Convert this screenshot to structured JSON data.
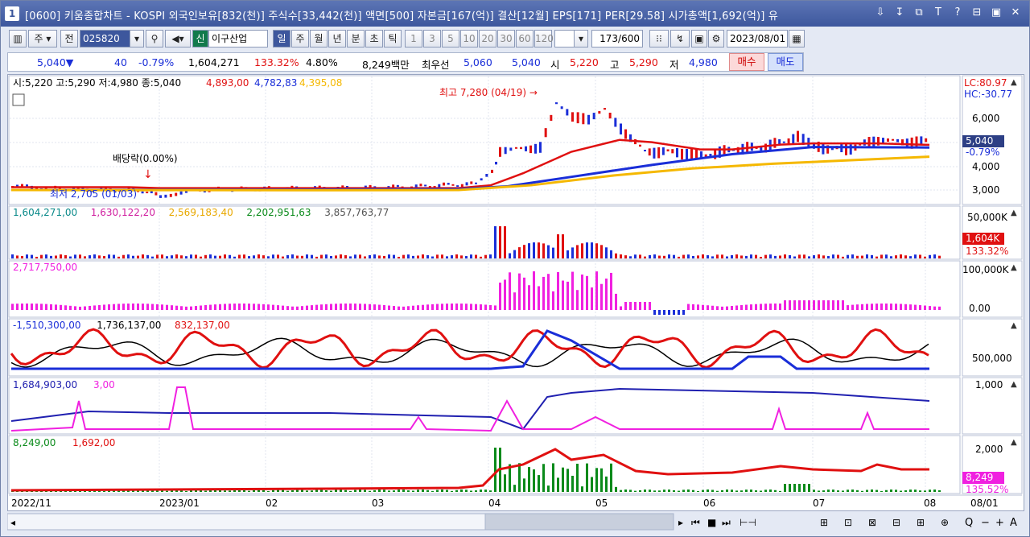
{
  "title": {
    "window_num": "1",
    "text": "[0600] 키움종합차트 - KOSPI 외국인보유[832(천)] 주식수[33,442(천)] 액면[500] 자본금[167(억)] 결산[12월] EPS[171] PER[29.58] 시가총액[1,692(억)] 유",
    "buttons": [
      "⇩",
      "↧",
      "⧉",
      "T",
      "?",
      "⊟",
      "▣",
      "✕"
    ]
  },
  "toolbar": {
    "period": "주",
    "prev": "전",
    "code": "025820",
    "stock_badge": "신",
    "stock_name": "이구산업",
    "intervals": [
      "일",
      "주",
      "월",
      "년",
      "분",
      "초",
      "틱"
    ],
    "numbers": [
      "1",
      "3",
      "5",
      "10",
      "20",
      "30",
      "60",
      "120"
    ],
    "count": "173/600",
    "date": "2023/08/01"
  },
  "quote": {
    "price": "5,040▼",
    "change": "40",
    "pct": "-0.79%",
    "volume": "1,604,271",
    "vol_ratio": "133.32%",
    "turnover": "4.80%",
    "amount": "8,249백만",
    "best_label": "최우선",
    "ask": "5,060",
    "bid": "5,040",
    "open_label": "시",
    "open": "5,220",
    "high_label": "고",
    "high": "5,290",
    "low_label": "저",
    "low": "4,980",
    "buy": "매수",
    "sell": "매도"
  },
  "panels": {
    "price_legend": "시:5,220 고:5,290 저:4,980 종:5,040",
    "ma1": "4,893,00",
    "ma2": "4,782,83",
    "ma3": "4,395,08",
    "lc": "LC:80.97",
    "hc": "HC:-30.77",
    "peak": "최고 7,280 (04/19)",
    "trough": "최저 2,705 (01/03)",
    "dividend": "배당락(0.00%)",
    "price_axis": [
      "6,000",
      "5,000",
      "4,000",
      "3,000"
    ],
    "cur_price": "5,040",
    "cur_pct": "-0.79%",
    "vol_legend": [
      "1,604,271,00",
      "1,630,122,20",
      "2,569,183,40",
      "2,202,951,63",
      "3,857,763,77"
    ],
    "vol_axis": "50,000K",
    "vol_cur": "1,604K",
    "vol_cur_pct": "133.32%",
    "p3_legend": "2,717,750,00",
    "p3_axis": [
      "100,000K",
      "0.00"
    ],
    "p4_legend": [
      "-1,510,300,00",
      "1,736,137,00",
      "832,137,00"
    ],
    "p4_axis": "500,000",
    "p5_legend": [
      "1,684,903,00",
      "3,00"
    ],
    "p5_axis": "1,000",
    "p6_legend": [
      "8,249,00",
      "1,692,00"
    ],
    "p6_axis": "2,000",
    "p6_cur": "8,249",
    "p6_cur_pct": "135.52%",
    "x_labels": [
      "2022/11",
      "2023/01",
      "02",
      "03",
      "04",
      "05",
      "06",
      "07",
      "08",
      "08/01"
    ]
  },
  "colors": {
    "up": "#e01010",
    "down": "#1a2ed8",
    "ma3": "#f5b800",
    "magenta": "#f020e0",
    "navy": "#2020b0",
    "green": "#0a8a1a"
  }
}
